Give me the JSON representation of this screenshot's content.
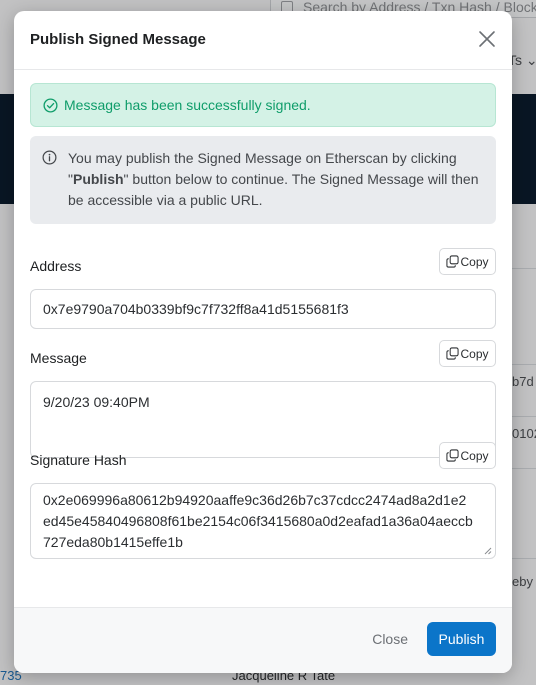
{
  "background": {
    "search_placeholder": "Search by Address / Txn Hash / Block",
    "nav_fragment": "Ts",
    "right_fragments": [
      "b7d",
      "0102",
      "eby v"
    ],
    "left_link_fragment": "735",
    "bottom_name": "Jacqueline R Tate"
  },
  "modal": {
    "title": "Publish Signed Message",
    "success_message": "Message has been successfully signed.",
    "info": {
      "before": "You may publish the Signed Message on Etherscan by clicking \"",
      "bold": "Publish",
      "after": "\" button below to continue. The Signed Message will then be accessible via a public URL."
    },
    "copy_label": "Copy",
    "address": {
      "label": "Address",
      "value": "0x7e9790a704b0339bf9c7f732ff8a41d5155681f3"
    },
    "message": {
      "label": "Message",
      "value": "9/20/23 09:40PM"
    },
    "signature": {
      "label": "Signature Hash",
      "value": "0x2e069996a80612b94920aaffe9c36d26b7c37cdcc2474ad8a2d1e2ed45e45840496808f61be2154c06f3415680a0d2eafad1a36a04aeccb727eda80b1415effe1b"
    },
    "footer": {
      "close_label": "Close",
      "publish_label": "Publish"
    }
  },
  "colors": {
    "success_bg": "#d4f2e6",
    "success_text": "#0f9d6a",
    "primary": "#0b75c9"
  }
}
